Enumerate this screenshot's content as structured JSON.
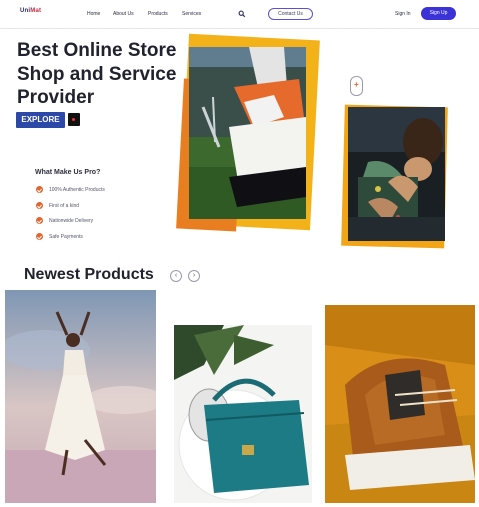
{
  "brand": {
    "name_part1": "Uni",
    "name_part2": "Mat"
  },
  "nav": {
    "links": [
      "Home",
      "About Us",
      "Products",
      "Services"
    ],
    "contact_label": "Contact Us",
    "signin_label": "Sign In",
    "signup_label": "Sign Up"
  },
  "hero": {
    "title": "Best Online Store Shop and Service Provider",
    "explore_label": "EXPLORE",
    "pro_title": "What Make Us Pro?",
    "pro_items": [
      "100% Authentic Products",
      "First of a kind",
      "Nationwide Delivery",
      "Safe Payments"
    ]
  },
  "newest": {
    "title": "Newest Products",
    "prev_glyph": "‹",
    "next_glyph": "›"
  },
  "colors": {
    "accent": "#3b32d8",
    "explore": "#2c49a8",
    "orange": "#e3642c",
    "yellow": "#f4b21a"
  },
  "icons": [
    "search-icon",
    "play-icon",
    "check-icon",
    "plus-icon",
    "chevron-left-icon",
    "chevron-right-icon"
  ]
}
